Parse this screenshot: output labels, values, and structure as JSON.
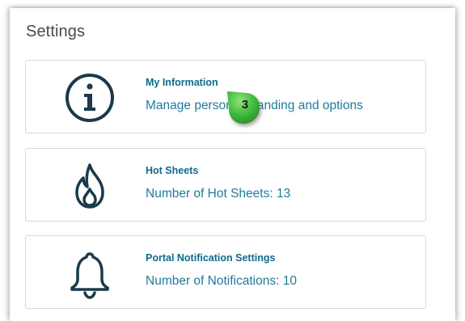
{
  "header": {
    "title": "Settings"
  },
  "cards": [
    {
      "title": "My Information",
      "description": "Manage personal branding and options",
      "icon": "info-icon"
    },
    {
      "title": "Hot Sheets",
      "description": "Number of Hot Sheets: 13",
      "icon": "flame-icon"
    },
    {
      "title": "Portal Notification Settings",
      "description": "Number of Notifications: 10",
      "icon": "bell-icon"
    }
  ],
  "step_badge": {
    "number": "3",
    "color": "#3db83a"
  },
  "colors": {
    "icon_stroke": "#1b3a4b",
    "link_title": "#0d6b8a",
    "link_desc": "#1f7a9c"
  }
}
